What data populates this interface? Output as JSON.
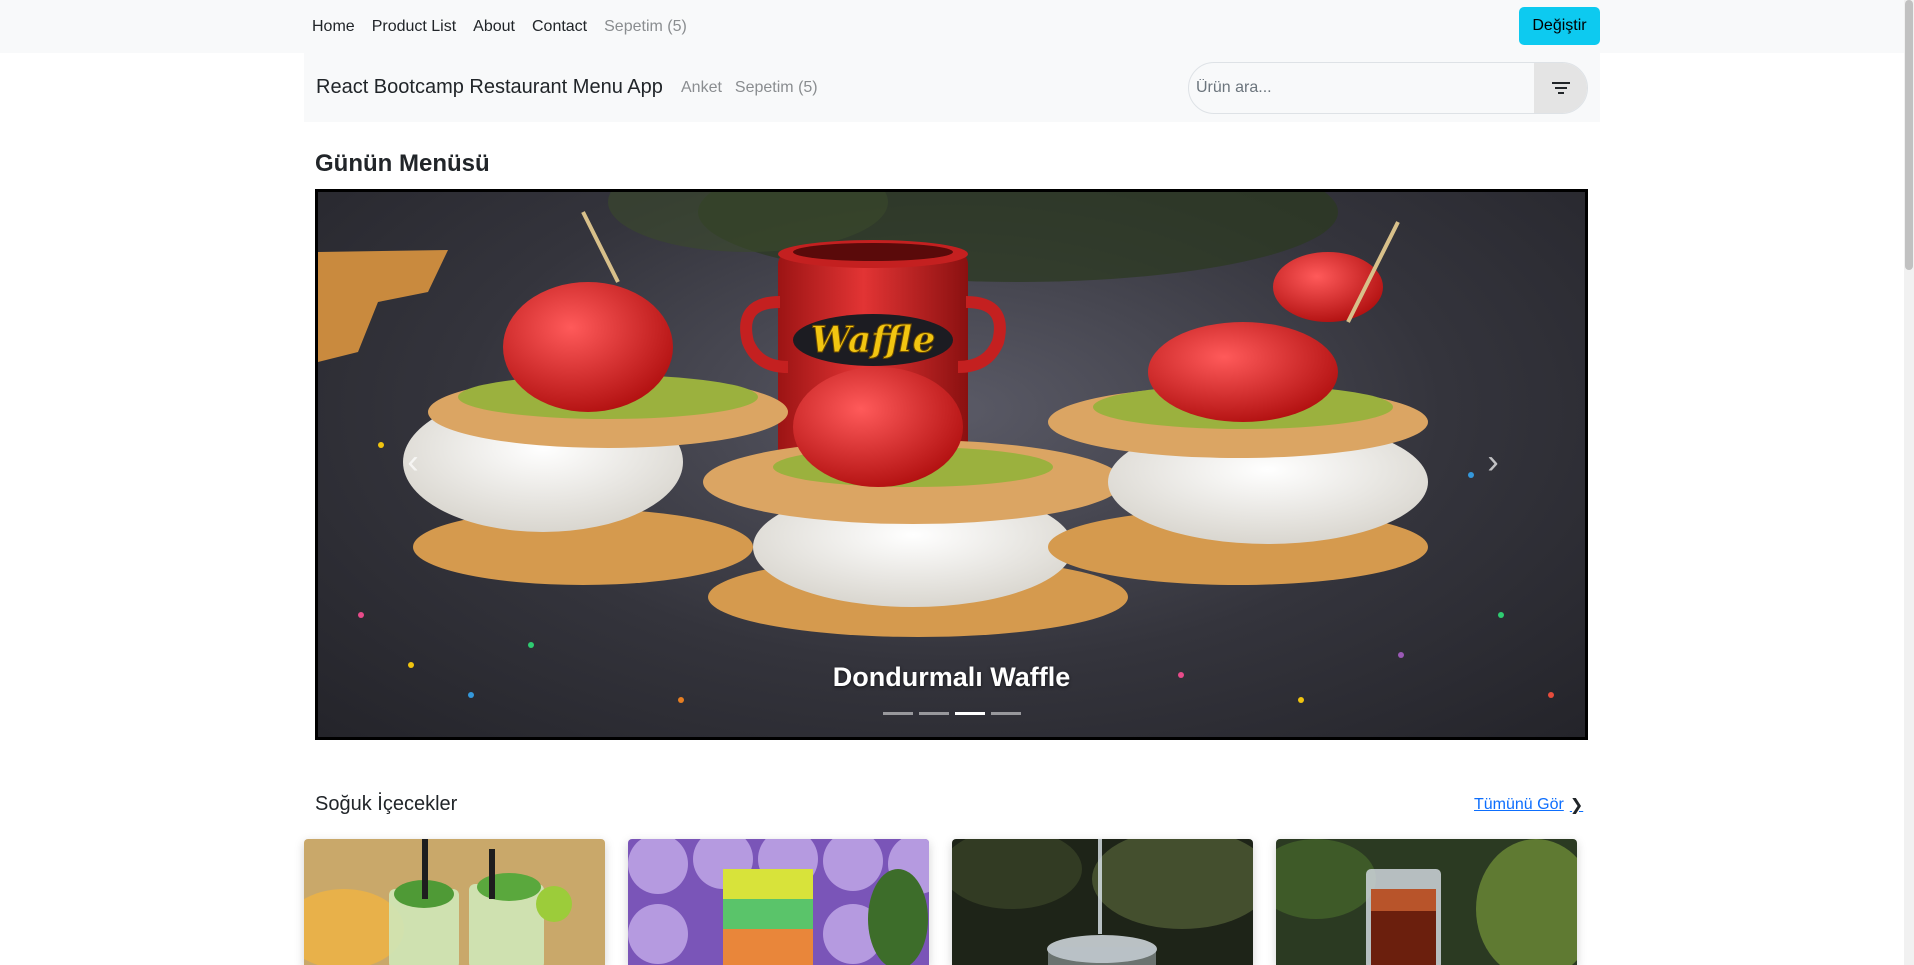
{
  "top_nav": {
    "links": [
      "Home",
      "Product List",
      "About",
      "Contact"
    ],
    "cart_label": "Sepetim (5)",
    "change_button": "Değiştir"
  },
  "sub_nav": {
    "brand": "React Bootcamp Restaurant Menu App",
    "survey_link": "Anket",
    "cart_link": "Sepetim (5)",
    "search_placeholder": "Ürün ara...",
    "filter_icon": "filter-icon"
  },
  "daily_menu": {
    "title": "Günün Menüsü",
    "carousel": {
      "caption": "Dondurmalı Waffle",
      "logo_text": "Waffle",
      "slide_count": 4,
      "active_slide": 3,
      "prev_icon": "chevron-left-icon",
      "next_icon": "chevron-right-icon"
    }
  },
  "cold_drinks": {
    "title": "Soğuk İçecekler",
    "see_all": "Tümünü Gör",
    "see_all_icon": "chevron-right-icon",
    "cards": [
      "mojito-image",
      "layered-drink-image",
      "sparkling-water-image",
      "iced-tea-image"
    ]
  },
  "colors": {
    "accent_button": "#0dcaf0",
    "link": "#0d6efd",
    "navbar_bg": "#f8f9fa"
  }
}
